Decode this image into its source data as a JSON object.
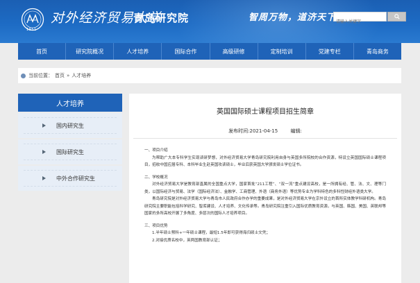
{
  "header": {
    "school_name": "对外经济贸易大学",
    "institute": "青岛研究院",
    "logo_year": "1951",
    "slogan": "智周万物，道济天下",
    "search": {
      "placeholder": "请输入关键字"
    }
  },
  "nav": {
    "items": [
      "首页",
      "研究院概况",
      "人才培养",
      "国际合作",
      "高级研修",
      "定制培训",
      "党建专栏",
      "青岛商务"
    ]
  },
  "breadcrumb": {
    "label": "当前位置：",
    "home": "首页",
    "separator": "»",
    "current": "人才培养"
  },
  "sidebar": {
    "title": "人才培养",
    "items": [
      "国内研究生",
      "国际研究生",
      "中外合作研究生"
    ]
  },
  "article": {
    "title": "英国国际硕士课程项目招生简章",
    "date": "发布时间:2021-04-15",
    "editor": "编辑:",
    "sections": [
      {
        "heading": "一、项目介绍",
        "text": "为帮助广大本专科学生实现读研梦想，对外经济贸易大学青岛研究院利用自身与英国多所院校的合作资源，特设立英国国际硕士课程项目，招收中国应届专科、本科毕业生赴英国攻读硕士，毕业后获英国大学颁发硕士学位证书。"
      },
      {
        "heading": "二、学校概况",
        "text": "对外经济贸易大学是教育部直属的全国重点大学，国家首批“211工程”、“双一流”重点建设高校，是一所拥有经、管、法、文、理等门类，以国际经济与贸易、法学（国际经济法）、金融学、工商管理、外语（商务外语）等优势专业为学科特色的多科性财经外语类大学。"
      },
      {
        "heading": "",
        "text": "青岛研究院是对外经济贸易大学与青岛市人民政府合作办学的重要成果，是对外经济贸易大学在京外设立的首所实体教学科研机构。青岛研究院主要职能包括科学研究、智库建设、人才培养、文化传承等。青岛研究院注重引入国际优质教育资源，与英国、韩国、美国、英联邦等国家的多所高校开展了多角度、多层次的国际人才培养项目。"
      },
      {
        "heading": "三、项目优势",
        "text": ""
      },
      {
        "heading": "",
        "text": "1.半年硕士预科+一年硕士课程，最短1.5年即可获得海归硕士文凭；"
      },
      {
        "heading": "",
        "text": "2.对接优质名校中，英两国教育部认证；"
      }
    ]
  },
  "colors": {
    "header_blue": "#1b5fb3",
    "nav_blue": "#1f63b8",
    "sidebar_item_bg": "#e7eef7",
    "page_bg": "#ececec"
  }
}
